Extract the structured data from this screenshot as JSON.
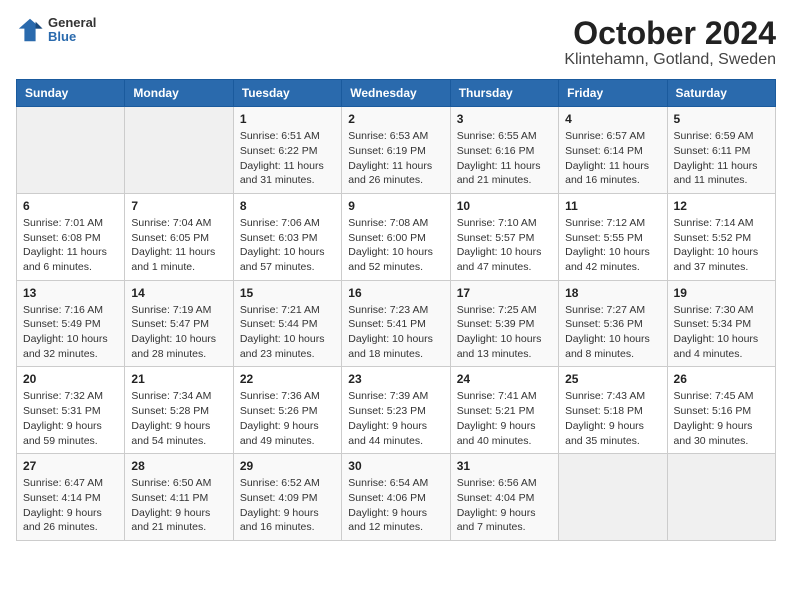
{
  "header": {
    "title": "October 2024",
    "subtitle": "Klintehamn, Gotland, Sweden",
    "logo_general": "General",
    "logo_blue": "Blue"
  },
  "weekdays": [
    "Sunday",
    "Monday",
    "Tuesday",
    "Wednesday",
    "Thursday",
    "Friday",
    "Saturday"
  ],
  "weeks": [
    [
      {
        "day": "",
        "sunrise": "",
        "sunset": "",
        "daylight": ""
      },
      {
        "day": "",
        "sunrise": "",
        "sunset": "",
        "daylight": ""
      },
      {
        "day": "1",
        "sunrise": "Sunrise: 6:51 AM",
        "sunset": "Sunset: 6:22 PM",
        "daylight": "Daylight: 11 hours and 31 minutes."
      },
      {
        "day": "2",
        "sunrise": "Sunrise: 6:53 AM",
        "sunset": "Sunset: 6:19 PM",
        "daylight": "Daylight: 11 hours and 26 minutes."
      },
      {
        "day": "3",
        "sunrise": "Sunrise: 6:55 AM",
        "sunset": "Sunset: 6:16 PM",
        "daylight": "Daylight: 11 hours and 21 minutes."
      },
      {
        "day": "4",
        "sunrise": "Sunrise: 6:57 AM",
        "sunset": "Sunset: 6:14 PM",
        "daylight": "Daylight: 11 hours and 16 minutes."
      },
      {
        "day": "5",
        "sunrise": "Sunrise: 6:59 AM",
        "sunset": "Sunset: 6:11 PM",
        "daylight": "Daylight: 11 hours and 11 minutes."
      }
    ],
    [
      {
        "day": "6",
        "sunrise": "Sunrise: 7:01 AM",
        "sunset": "Sunset: 6:08 PM",
        "daylight": "Daylight: 11 hours and 6 minutes."
      },
      {
        "day": "7",
        "sunrise": "Sunrise: 7:04 AM",
        "sunset": "Sunset: 6:05 PM",
        "daylight": "Daylight: 11 hours and 1 minute."
      },
      {
        "day": "8",
        "sunrise": "Sunrise: 7:06 AM",
        "sunset": "Sunset: 6:03 PM",
        "daylight": "Daylight: 10 hours and 57 minutes."
      },
      {
        "day": "9",
        "sunrise": "Sunrise: 7:08 AM",
        "sunset": "Sunset: 6:00 PM",
        "daylight": "Daylight: 10 hours and 52 minutes."
      },
      {
        "day": "10",
        "sunrise": "Sunrise: 7:10 AM",
        "sunset": "Sunset: 5:57 PM",
        "daylight": "Daylight: 10 hours and 47 minutes."
      },
      {
        "day": "11",
        "sunrise": "Sunrise: 7:12 AM",
        "sunset": "Sunset: 5:55 PM",
        "daylight": "Daylight: 10 hours and 42 minutes."
      },
      {
        "day": "12",
        "sunrise": "Sunrise: 7:14 AM",
        "sunset": "Sunset: 5:52 PM",
        "daylight": "Daylight: 10 hours and 37 minutes."
      }
    ],
    [
      {
        "day": "13",
        "sunrise": "Sunrise: 7:16 AM",
        "sunset": "Sunset: 5:49 PM",
        "daylight": "Daylight: 10 hours and 32 minutes."
      },
      {
        "day": "14",
        "sunrise": "Sunrise: 7:19 AM",
        "sunset": "Sunset: 5:47 PM",
        "daylight": "Daylight: 10 hours and 28 minutes."
      },
      {
        "day": "15",
        "sunrise": "Sunrise: 7:21 AM",
        "sunset": "Sunset: 5:44 PM",
        "daylight": "Daylight: 10 hours and 23 minutes."
      },
      {
        "day": "16",
        "sunrise": "Sunrise: 7:23 AM",
        "sunset": "Sunset: 5:41 PM",
        "daylight": "Daylight: 10 hours and 18 minutes."
      },
      {
        "day": "17",
        "sunrise": "Sunrise: 7:25 AM",
        "sunset": "Sunset: 5:39 PM",
        "daylight": "Daylight: 10 hours and 13 minutes."
      },
      {
        "day": "18",
        "sunrise": "Sunrise: 7:27 AM",
        "sunset": "Sunset: 5:36 PM",
        "daylight": "Daylight: 10 hours and 8 minutes."
      },
      {
        "day": "19",
        "sunrise": "Sunrise: 7:30 AM",
        "sunset": "Sunset: 5:34 PM",
        "daylight": "Daylight: 10 hours and 4 minutes."
      }
    ],
    [
      {
        "day": "20",
        "sunrise": "Sunrise: 7:32 AM",
        "sunset": "Sunset: 5:31 PM",
        "daylight": "Daylight: 9 hours and 59 minutes."
      },
      {
        "day": "21",
        "sunrise": "Sunrise: 7:34 AM",
        "sunset": "Sunset: 5:28 PM",
        "daylight": "Daylight: 9 hours and 54 minutes."
      },
      {
        "day": "22",
        "sunrise": "Sunrise: 7:36 AM",
        "sunset": "Sunset: 5:26 PM",
        "daylight": "Daylight: 9 hours and 49 minutes."
      },
      {
        "day": "23",
        "sunrise": "Sunrise: 7:39 AM",
        "sunset": "Sunset: 5:23 PM",
        "daylight": "Daylight: 9 hours and 44 minutes."
      },
      {
        "day": "24",
        "sunrise": "Sunrise: 7:41 AM",
        "sunset": "Sunset: 5:21 PM",
        "daylight": "Daylight: 9 hours and 40 minutes."
      },
      {
        "day": "25",
        "sunrise": "Sunrise: 7:43 AM",
        "sunset": "Sunset: 5:18 PM",
        "daylight": "Daylight: 9 hours and 35 minutes."
      },
      {
        "day": "26",
        "sunrise": "Sunrise: 7:45 AM",
        "sunset": "Sunset: 5:16 PM",
        "daylight": "Daylight: 9 hours and 30 minutes."
      }
    ],
    [
      {
        "day": "27",
        "sunrise": "Sunrise: 6:47 AM",
        "sunset": "Sunset: 4:14 PM",
        "daylight": "Daylight: 9 hours and 26 minutes."
      },
      {
        "day": "28",
        "sunrise": "Sunrise: 6:50 AM",
        "sunset": "Sunset: 4:11 PM",
        "daylight": "Daylight: 9 hours and 21 minutes."
      },
      {
        "day": "29",
        "sunrise": "Sunrise: 6:52 AM",
        "sunset": "Sunset: 4:09 PM",
        "daylight": "Daylight: 9 hours and 16 minutes."
      },
      {
        "day": "30",
        "sunrise": "Sunrise: 6:54 AM",
        "sunset": "Sunset: 4:06 PM",
        "daylight": "Daylight: 9 hours and 12 minutes."
      },
      {
        "day": "31",
        "sunrise": "Sunrise: 6:56 AM",
        "sunset": "Sunset: 4:04 PM",
        "daylight": "Daylight: 9 hours and 7 minutes."
      },
      {
        "day": "",
        "sunrise": "",
        "sunset": "",
        "daylight": ""
      },
      {
        "day": "",
        "sunrise": "",
        "sunset": "",
        "daylight": ""
      }
    ]
  ]
}
